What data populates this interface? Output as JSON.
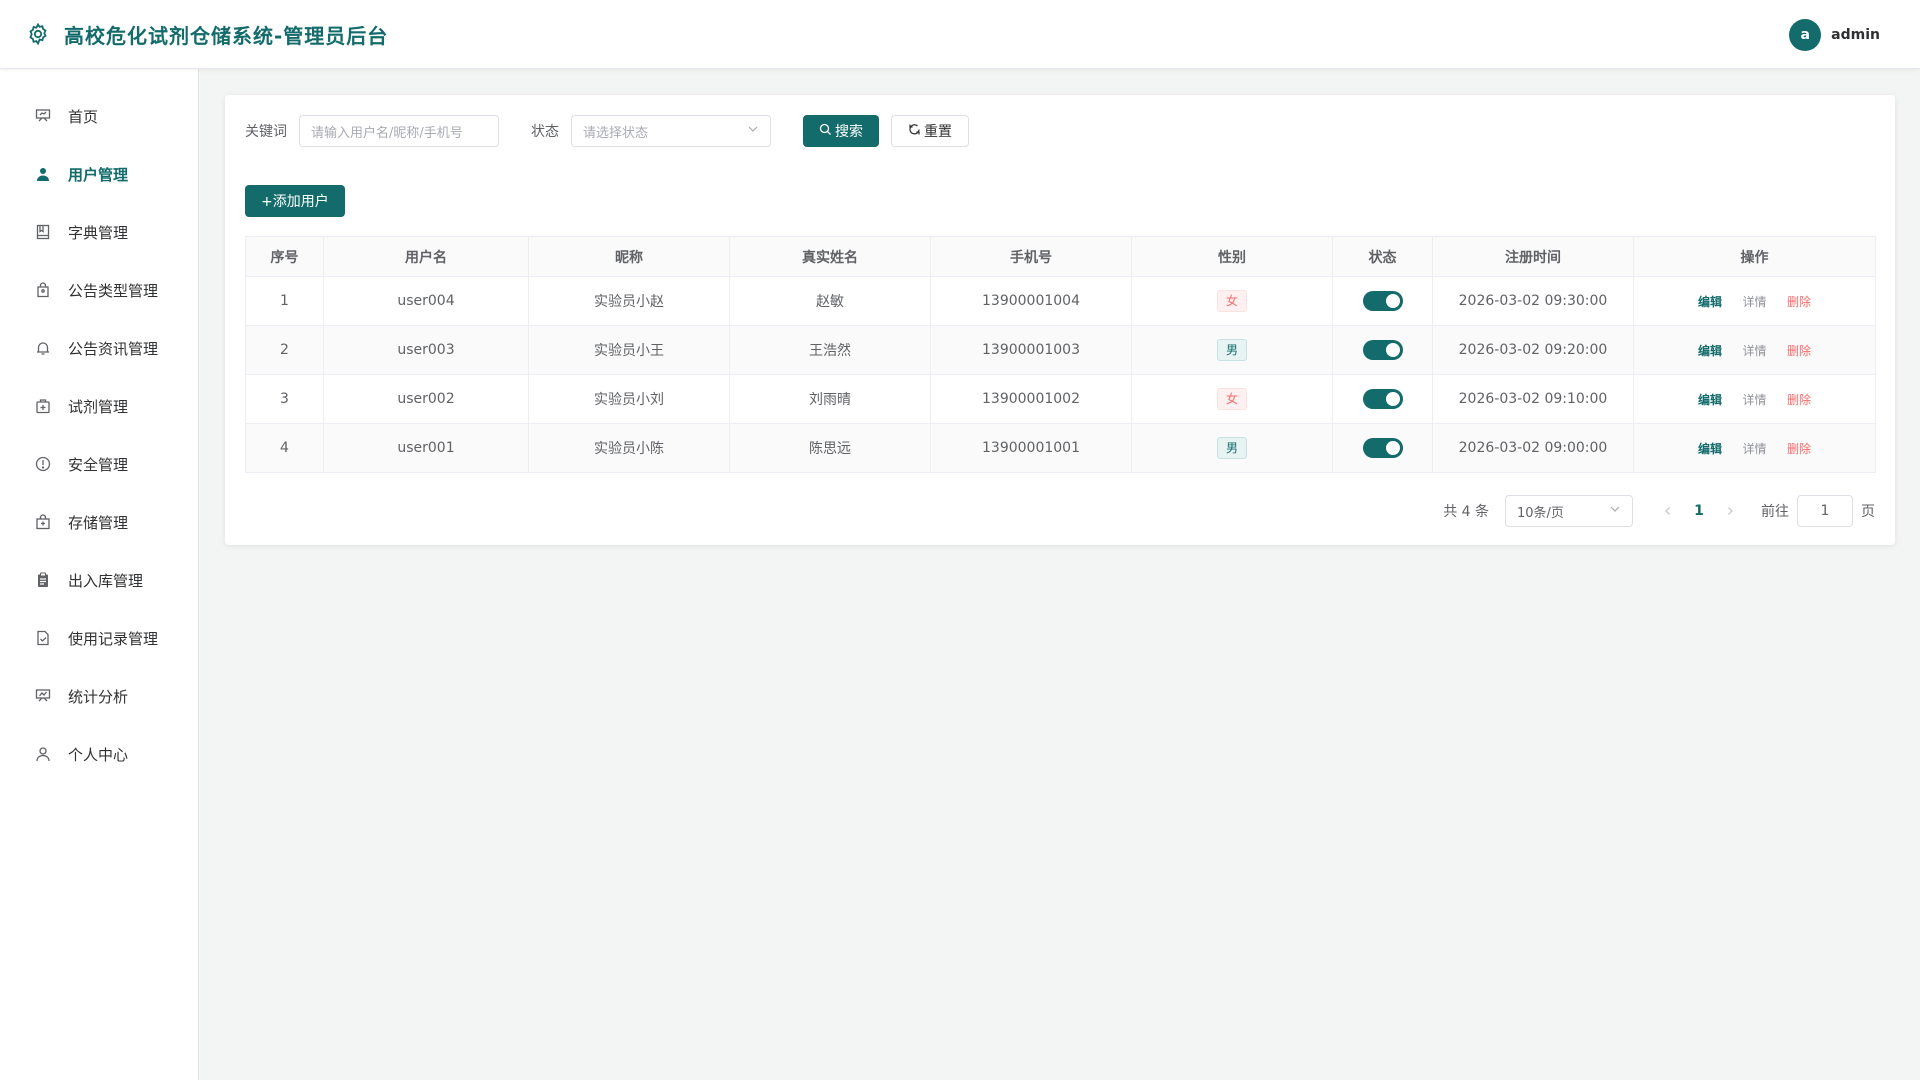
{
  "header": {
    "title": "高校危化试剂仓储系统-管理员后台",
    "avatar_letter": "a",
    "username": "admin"
  },
  "sidebar": {
    "items": [
      {
        "label": "首页",
        "icon": "presentation-board-icon",
        "active": false
      },
      {
        "label": "用户管理",
        "icon": "user-icon",
        "active": true
      },
      {
        "label": "字典管理",
        "icon": "notebook-icon",
        "active": false
      },
      {
        "label": "公告类型管理",
        "icon": "bag-icon",
        "active": false
      },
      {
        "label": "公告资讯管理",
        "icon": "bell-icon",
        "active": false
      },
      {
        "label": "试剂管理",
        "icon": "first-aid-kit-icon",
        "active": false
      },
      {
        "label": "安全管理",
        "icon": "warning-circle-icon",
        "active": false
      },
      {
        "label": "存储管理",
        "icon": "shopping-bag-icon",
        "active": false
      },
      {
        "label": "出入库管理",
        "icon": "clipboard-icon",
        "active": false
      },
      {
        "label": "使用记录管理",
        "icon": "document-check-icon",
        "active": false
      },
      {
        "label": "统计分析",
        "icon": "chart-board-icon",
        "active": false
      },
      {
        "label": "个人中心",
        "icon": "user-outline-icon",
        "active": false
      }
    ]
  },
  "filter": {
    "keyword_label": "关键词",
    "keyword_placeholder": "请输入用户名/昵称/手机号",
    "status_label": "状态",
    "status_placeholder": "请选择状态",
    "search_label": "搜索",
    "reset_label": "重置"
  },
  "add_button_label": "+添加用户",
  "table": {
    "headers": [
      "序号",
      "用户名",
      "昵称",
      "真实姓名",
      "手机号",
      "性别",
      "状态",
      "注册时间",
      "操作"
    ],
    "rows": [
      {
        "index": "1",
        "username": "user004",
        "nickname": "实验员小赵",
        "realname": "赵敏",
        "phone": "13900001004",
        "gender": "女",
        "enabled": true,
        "registered": "2026-03-02 09:30:00"
      },
      {
        "index": "2",
        "username": "user003",
        "nickname": "实验员小王",
        "realname": "王浩然",
        "phone": "13900001003",
        "gender": "男",
        "enabled": true,
        "registered": "2026-03-02 09:20:00"
      },
      {
        "index": "3",
        "username": "user002",
        "nickname": "实验员小刘",
        "realname": "刘雨晴",
        "phone": "13900001002",
        "gender": "女",
        "enabled": true,
        "registered": "2026-03-02 09:10:00"
      },
      {
        "index": "4",
        "username": "user001",
        "nickname": "实验员小陈",
        "realname": "陈思远",
        "phone": "13900001001",
        "gender": "男",
        "enabled": true,
        "registered": "2026-03-02 09:00:00"
      }
    ],
    "actions": {
      "edit": "编辑",
      "detail": "详情",
      "delete": "删除"
    }
  },
  "pagination": {
    "total_text": "共 4 条",
    "page_size": "10条/页",
    "current_page": "1",
    "goto_label": "前往",
    "goto_value": "1",
    "page_suffix": "页"
  },
  "colors": {
    "primary": "#136b6b",
    "danger": "#f56c6c",
    "background": "#f3f4f4"
  }
}
